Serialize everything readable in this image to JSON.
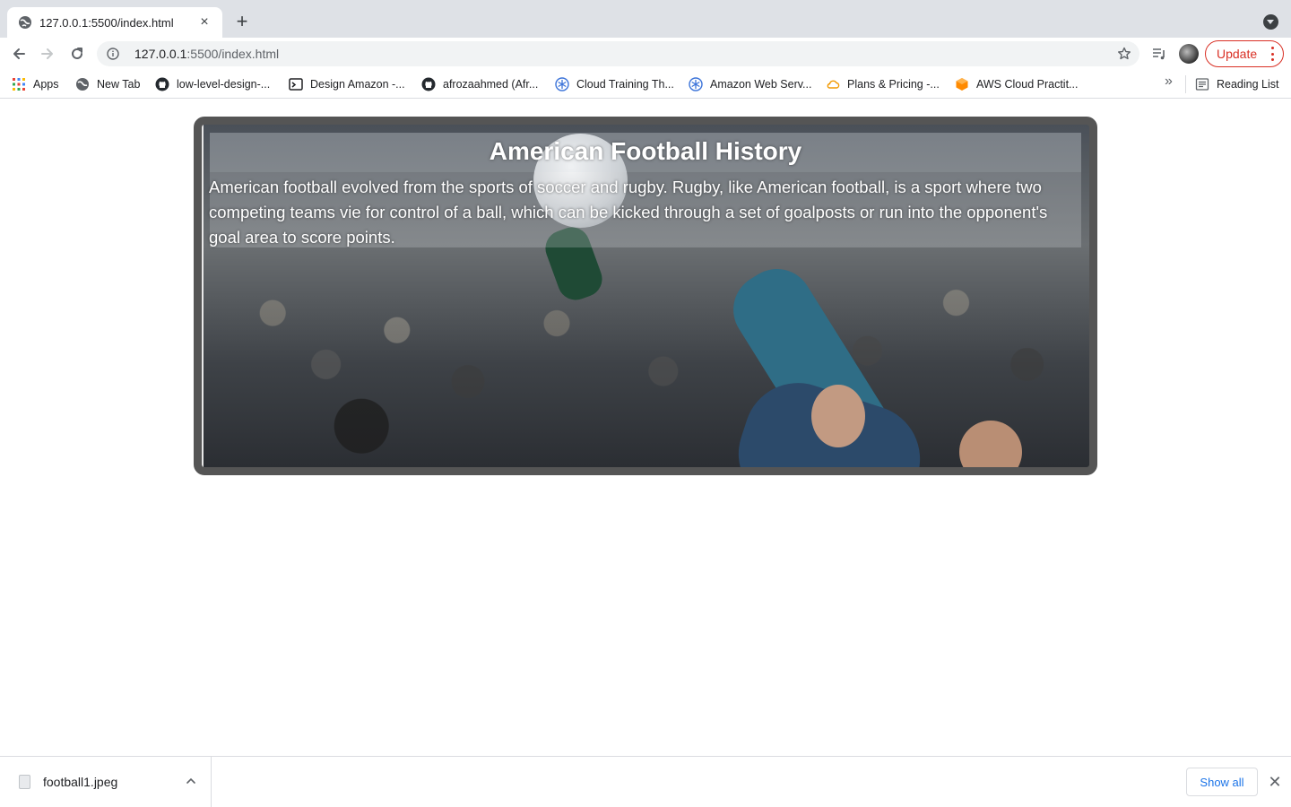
{
  "browser": {
    "tab": {
      "title": "127.0.0.1:5500/index.html",
      "favicon": "globe-icon"
    },
    "address": {
      "host": "127.0.0.1",
      "path": ":5500/index.html"
    },
    "update_label": "Update",
    "bookmarks": [
      {
        "label": "Apps",
        "icon": "apps-grid-icon"
      },
      {
        "label": "New Tab",
        "icon": "globe-icon"
      },
      {
        "label": "low-level-design-...",
        "icon": "github-icon"
      },
      {
        "label": "Design Amazon -...",
        "icon": "terminal-icon"
      },
      {
        "label": "afrozaahmed (Afr...",
        "icon": "github-icon"
      },
      {
        "label": "Cloud Training Th...",
        "icon": "snowflake-icon"
      },
      {
        "label": "Amazon Web Serv...",
        "icon": "snowflake-icon"
      },
      {
        "label": "Plans & Pricing -...",
        "icon": "cloud-icon"
      },
      {
        "label": "AWS Cloud Practit...",
        "icon": "hexagon-icon"
      }
    ],
    "overflow_label": "»",
    "reading_list_label": "Reading List"
  },
  "page": {
    "title": "American Football History",
    "paragraph": "American football evolved from the sports of soccer and rugby. Rugby, like American football, is a sport where two competing teams vie for control of a ball, which can be kicked through a set of goalposts or run into the opponent's goal area to score points."
  },
  "downloads": {
    "file_name": "football1.jpeg",
    "show_all_label": "Show all"
  },
  "colors": {
    "update_accent": "#d93025",
    "link_blue": "#1a73e8",
    "card_border": "#555555"
  }
}
